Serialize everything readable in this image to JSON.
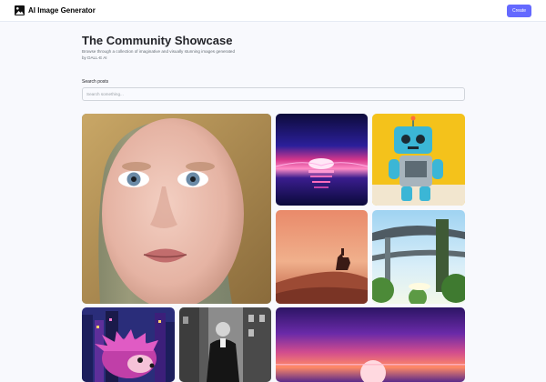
{
  "header": {
    "app_title": "AI Image Generator",
    "create_label": "Create",
    "logo_icon": "image-icon",
    "accent_color": "#6469ff"
  },
  "showcase": {
    "title": "The Community Showcase",
    "subtitle": "Browse through a collection of imaginative and visually stunning images generated by DALL-E AI"
  },
  "search": {
    "label": "Search posts",
    "placeholder": "Search something...",
    "value": ""
  },
  "gallery": {
    "items": [
      "portrait-woman-blue-eyes",
      "synthwave-sunset",
      "toy-robot",
      "desert-rider-silhouette",
      "futuristic-overpass",
      "hedgehog-city-pixel",
      "man-black-white-street",
      "purple-sunset-horizon"
    ]
  }
}
